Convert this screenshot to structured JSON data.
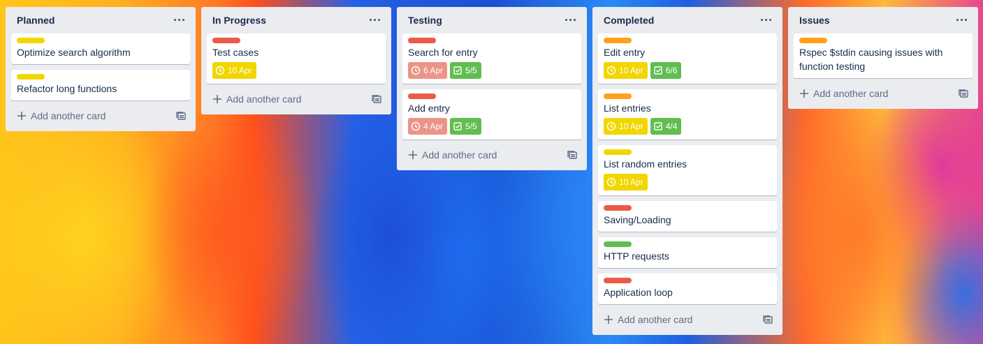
{
  "colors": {
    "yellow": "#f2d600",
    "red": "#eb5a46",
    "orange": "#ff9f1a",
    "green": "#61bd4f",
    "due_soon": "#f2d600",
    "overdue": "#ec9488",
    "checklist_done": "#61bd4f"
  },
  "lists": [
    {
      "title": "Planned",
      "cards": [
        {
          "label_color": "yellow",
          "title": "Optimize search algorithm"
        },
        {
          "label_color": "yellow",
          "title": "Refactor long functions"
        }
      ],
      "add_card_label": "Add another card"
    },
    {
      "title": "In Progress",
      "cards": [
        {
          "label_color": "red",
          "title": "Test cases",
          "due": "10 Apr",
          "due_state": "due_soon"
        }
      ],
      "add_card_label": "Add another card"
    },
    {
      "title": "Testing",
      "cards": [
        {
          "label_color": "red",
          "title": "Search for entry",
          "due": "6 Apr",
          "due_state": "overdue",
          "checklist": "5/5"
        },
        {
          "label_color": "red",
          "title": "Add entry",
          "due": "4 Apr",
          "due_state": "overdue",
          "checklist": "5/5"
        }
      ],
      "add_card_label": "Add another card"
    },
    {
      "title": "Completed",
      "cards": [
        {
          "label_color": "orange",
          "title": "Edit entry",
          "due": "10 Apr",
          "due_state": "due_soon",
          "checklist": "6/6"
        },
        {
          "label_color": "orange",
          "title": "List entries",
          "due": "10 Apr",
          "due_state": "due_soon",
          "checklist": "4/4"
        },
        {
          "label_color": "yellow",
          "title": "List random entries",
          "due": "10 Apr",
          "due_state": "due_soon"
        },
        {
          "label_color": "red",
          "title": "Saving/Loading"
        },
        {
          "label_color": "green",
          "title": "HTTP requests"
        },
        {
          "label_color": "red",
          "title": "Application loop"
        }
      ],
      "add_card_label": "Add another card"
    },
    {
      "title": "Issues",
      "cards": [
        {
          "label_color": "orange",
          "title": "Rspec $stdin causing issues with function testing"
        }
      ],
      "add_card_label": "Add another card"
    }
  ],
  "icons": {
    "list_menu": "ellipsis-icon",
    "add": "plus-icon",
    "template": "card-template-icon",
    "due": "clock-icon",
    "checklist": "checkbox-icon"
  }
}
